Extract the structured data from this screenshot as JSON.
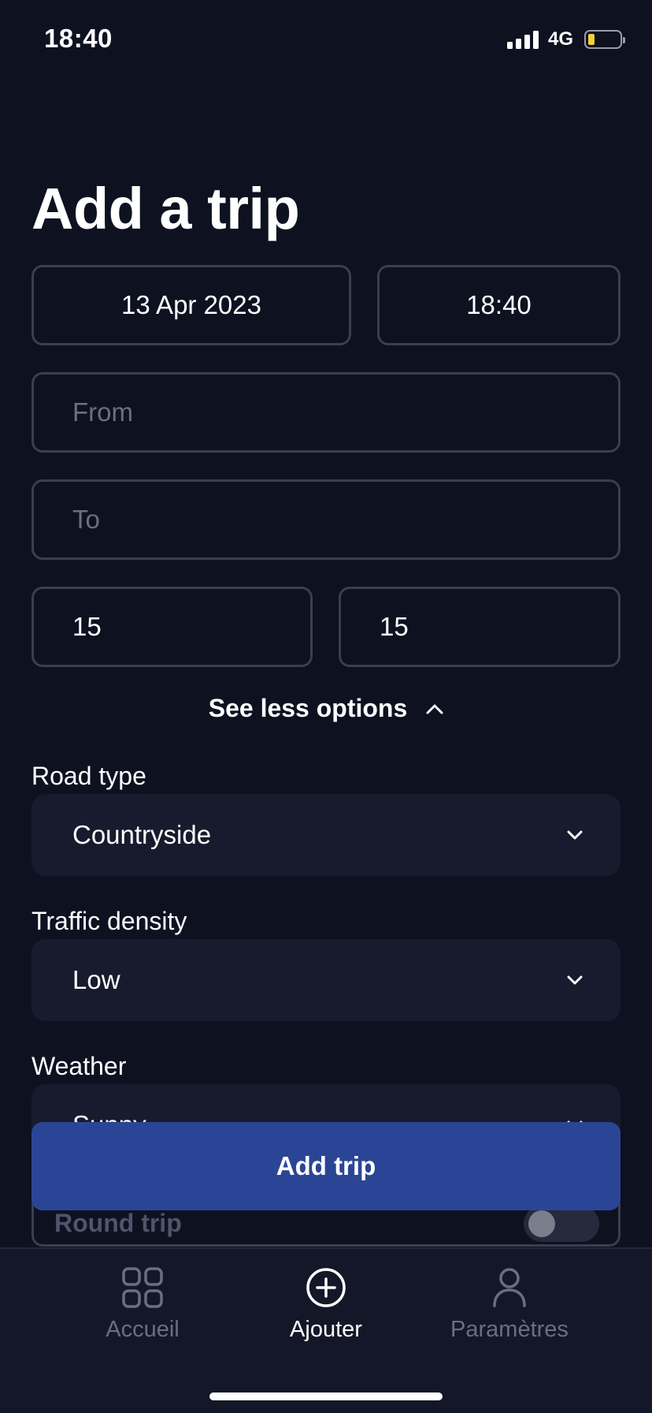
{
  "status_bar": {
    "time": "18:40",
    "network": "4G",
    "battery_icon": "battery-low-icon"
  },
  "page": {
    "title": "Add a trip"
  },
  "form": {
    "date": "13 Apr 2023",
    "time": "18:40",
    "from_placeholder": "From",
    "to_placeholder": "To",
    "field_left_value": "15",
    "field_right_value": "15",
    "see_less_label": "See less options",
    "road_type": {
      "label": "Road type",
      "value": "Countryside"
    },
    "traffic_density": {
      "label": "Traffic density",
      "value": "Low"
    },
    "weather": {
      "label": "Weather",
      "value": "Sunny"
    },
    "round_trip": {
      "label": "Round trip",
      "enabled": false
    }
  },
  "add_button_label": "Add trip",
  "tabbar": {
    "items": [
      {
        "label": "Accueil",
        "icon": "grid-icon",
        "active": false
      },
      {
        "label": "Ajouter",
        "icon": "plus-circle-icon",
        "active": true
      },
      {
        "label": "Paramètres",
        "icon": "person-icon",
        "active": false
      }
    ]
  },
  "colors": {
    "background": "#0e1120",
    "primary": "#2b4596",
    "surface": "#181b2d",
    "border": "#3a3e4e"
  }
}
